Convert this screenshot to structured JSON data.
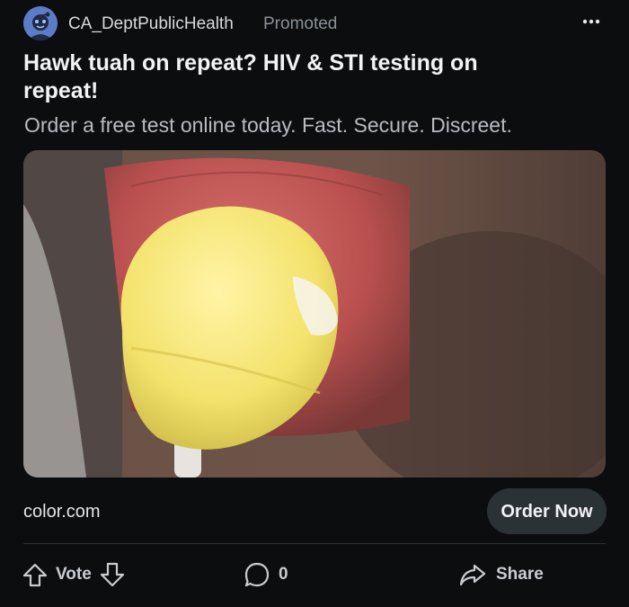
{
  "post": {
    "author": "CA_DeptPublicHealth",
    "badge": "Promoted",
    "title": "Hawk tuah on repeat? HIV & STI testing on repeat!",
    "subtitle": "Order a free test online today. Fast. Secure. Discreet.",
    "domain": "color.com",
    "cta": "Order Now"
  },
  "actions": {
    "vote_label": "Vote",
    "comment_count": "0",
    "share_label": "Share"
  },
  "icons": {
    "avatar": "reddit-avatar-icon",
    "more": "more-dots-icon",
    "upvote": "upvote-arrow-icon",
    "downvote": "downvote-arrow-icon",
    "comment": "comment-bubble-icon",
    "share": "share-arrow-icon"
  },
  "colors": {
    "background": "#0b0d0f",
    "button": "#2b3236",
    "muted_text": "#8b9196"
  }
}
